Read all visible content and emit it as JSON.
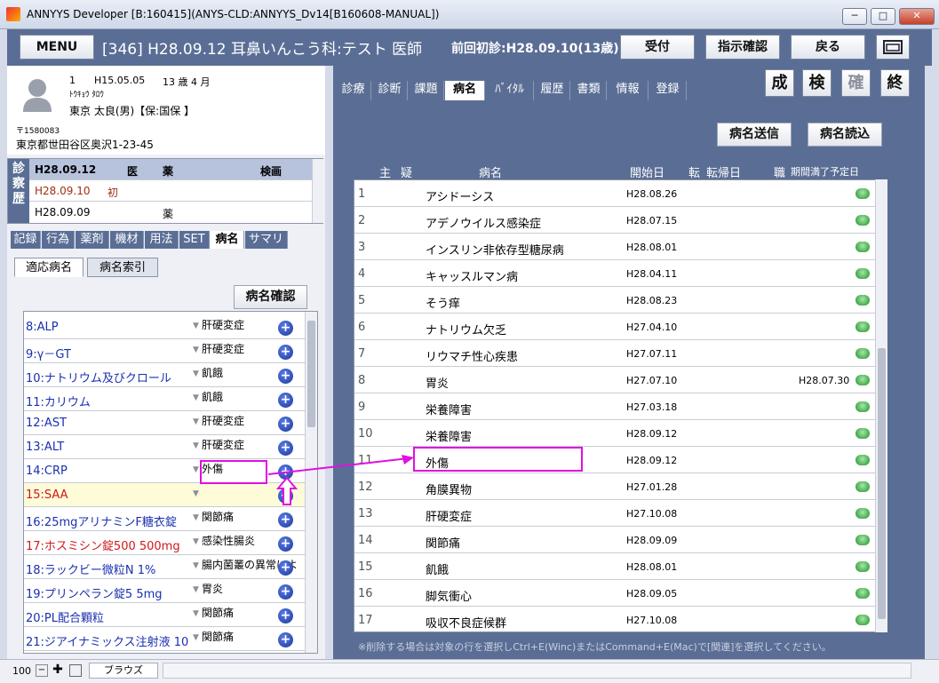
{
  "window": {
    "title": "ANNYYS Developer [B:160415](ANYS-CLD:ANNYYS_Dv14[B160608-MANUAL])",
    "minimize": "─",
    "maximize": "□",
    "close": "✕"
  },
  "header": {
    "menu": "MENU",
    "patient_info": "[346] H28.09.12 耳鼻いんこう科:テスト 医師",
    "prev_visit": "前回初診:H28.09.10(13歳)",
    "accept": "受付",
    "instruction_confirm": "指示確認",
    "back": "戻る"
  },
  "patient": {
    "number": "1",
    "birth": "H15.05.05",
    "age": "13 歳 4 月",
    "kana": "ﾄｳｷｮｳ ﾀﾛｳ",
    "name": "東京 太良(男)【保:国保 】",
    "zip": "〒1580083",
    "address": "東京都世田谷区奥沢1-23-45"
  },
  "history": {
    "side_label": "診察歴",
    "header": {
      "date": "H28.09.12",
      "c1": "医",
      "c2": "薬",
      "c3": "検画"
    },
    "rows": [
      {
        "date": "H28.09.10",
        "mark": "初"
      },
      {
        "date": "H28.09.09",
        "mark": "薬"
      }
    ]
  },
  "left_tabs": [
    "記録",
    "行為",
    "薬剤",
    "機材",
    "用法",
    "SET",
    "病名",
    "サマリ"
  ],
  "dx_subtabs": [
    "適応病名",
    "病名索引"
  ],
  "dx_confirm": "病名確認",
  "left_items": [
    {
      "name": "8:ALP",
      "color": "#1a2fb0",
      "dx": "肝硬変症"
    },
    {
      "name": "9:γ－GT",
      "color": "#1a2fb0",
      "dx": "肝硬変症"
    },
    {
      "name": "10:ナトリウム及びクロール",
      "color": "#1a2fb0",
      "dx": "飢餓"
    },
    {
      "name": "11:カリウム",
      "color": "#1a2fb0",
      "dx": "飢餓"
    },
    {
      "name": "12:AST",
      "color": "#1a2fb0",
      "dx": "肝硬変症"
    },
    {
      "name": "13:ALT",
      "color": "#1a2fb0",
      "dx": "肝硬変症"
    },
    {
      "name": "14:CRP",
      "color": "#1a2fb0",
      "dx": "外傷"
    },
    {
      "name": "15:SAA",
      "color": "#d01818",
      "dx": ""
    },
    {
      "name": "16:25mgアリナミンF糖衣錠",
      "color": "#1a2fb0",
      "dx": "関節痛"
    },
    {
      "name": "17:ホスミシン錠500 500mg",
      "color": "#d01818",
      "dx": "感染性腸炎"
    },
    {
      "name": "18:ラックビー微粒N 1%",
      "color": "#1a2fb0",
      "dx": "腸内菌叢の異常によ"
    },
    {
      "name": "19:プリンペラン錠5 5mg",
      "color": "#1a2fb0",
      "dx": "胃炎"
    },
    {
      "name": "20:PL配合顆粒",
      "color": "#1a2fb0",
      "dx": "関節痛"
    },
    {
      "name": "21:ジアイナミックス注射液 10",
      "color": "#1a2fb0",
      "dx": "関節痛"
    }
  ],
  "right_tabs": [
    "診療",
    "診断",
    "課題",
    "病名",
    "ﾊﾞｲﾀﾙ",
    "履歴",
    "書類",
    "情報",
    "登録"
  ],
  "square_buttons": [
    "成",
    "検",
    "確",
    "終"
  ],
  "send_button": "病名送信",
  "read_button": "病名読込",
  "grid_headers": {
    "main": "主",
    "suspect": "疑",
    "disease": "病名",
    "start": "開始日",
    "outcome": "転",
    "outcome_date": "転帰日",
    "occupation": "職",
    "expiry": "期間満了予定日"
  },
  "diseases": [
    {
      "no": "1",
      "name": "アシドーシス",
      "start": "H28.08.26",
      "expiry": ""
    },
    {
      "no": "2",
      "name": "アデノウイルス感染症",
      "start": "H28.07.15",
      "expiry": ""
    },
    {
      "no": "3",
      "name": "インスリン非依存型糖尿病",
      "start": "H28.08.01",
      "expiry": ""
    },
    {
      "no": "4",
      "name": "キャッスルマン病",
      "start": "H28.04.11",
      "expiry": ""
    },
    {
      "no": "5",
      "name": "そう痒",
      "start": "H28.08.23",
      "expiry": ""
    },
    {
      "no": "6",
      "name": "ナトリウム欠乏",
      "start": "H27.04.10",
      "expiry": ""
    },
    {
      "no": "7",
      "name": "リウマチ性心疾患",
      "start": "H27.07.11",
      "expiry": ""
    },
    {
      "no": "8",
      "name": "胃炎",
      "start": "H27.07.10",
      "expiry": "H28.07.30"
    },
    {
      "no": "9",
      "name": "栄養障害",
      "start": "H27.03.18",
      "expiry": ""
    },
    {
      "no": "10",
      "name": "栄養障害",
      "start": "H28.09.12",
      "expiry": ""
    },
    {
      "no": "11",
      "name": "外傷",
      "start": "H28.09.12",
      "expiry": ""
    },
    {
      "no": "12",
      "name": "角膜異物",
      "start": "H27.01.28",
      "expiry": ""
    },
    {
      "no": "13",
      "name": "肝硬変症",
      "start": "H27.10.08",
      "expiry": ""
    },
    {
      "no": "14",
      "name": "関節痛",
      "start": "H28.09.09",
      "expiry": ""
    },
    {
      "no": "15",
      "name": "飢餓",
      "start": "H28.08.01",
      "expiry": ""
    },
    {
      "no": "16",
      "name": "脚気衝心",
      "start": "H28.09.05",
      "expiry": ""
    },
    {
      "no": "17",
      "name": "吸収不良症候群",
      "start": "H27.10.08",
      "expiry": ""
    }
  ],
  "footer_note": "※削除する場合は対象の行を選択しCtrl+E(Winc)またはCommand+E(Mac)で[関連]を選択してください。",
  "status": {
    "zoom": "100",
    "browse": "ブラウズ"
  },
  "colors": {
    "panel": "#5a6e95",
    "highlight": "#e010e0"
  }
}
